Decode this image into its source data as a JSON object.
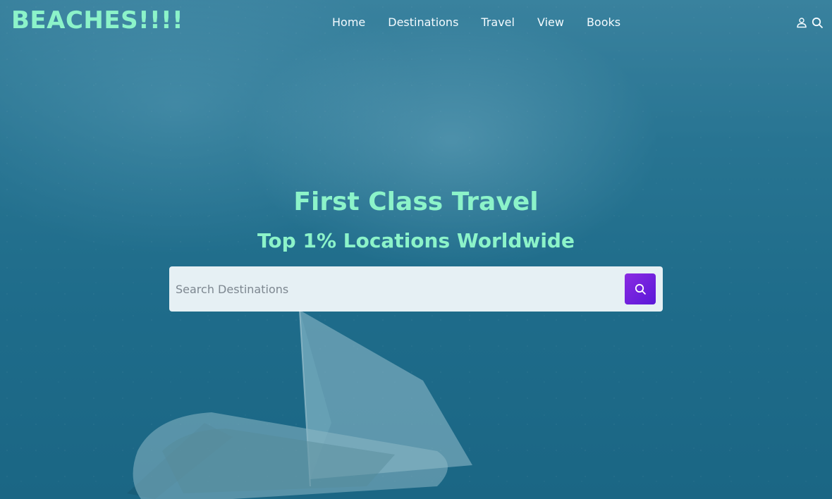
{
  "brand": {
    "logo_text": "BEACHES!!!!",
    "logo_color": "#8cf3c9"
  },
  "nav": {
    "links": [
      {
        "label": "Home"
      },
      {
        "label": "Destinations"
      },
      {
        "label": "Travel"
      },
      {
        "label": "View"
      },
      {
        "label": "Books"
      }
    ],
    "icons": [
      "user-icon",
      "search-icon"
    ]
  },
  "hero": {
    "title": "First Class Travel",
    "subtitle": "Top 1% Locations Worldwide",
    "background": "aerial-ocean-sailboat",
    "text_color": "#8cf3c9"
  },
  "search": {
    "placeholder": "Search Destinations",
    "value": "",
    "button_icon": "search-icon",
    "button_color": "#7b22e0"
  }
}
